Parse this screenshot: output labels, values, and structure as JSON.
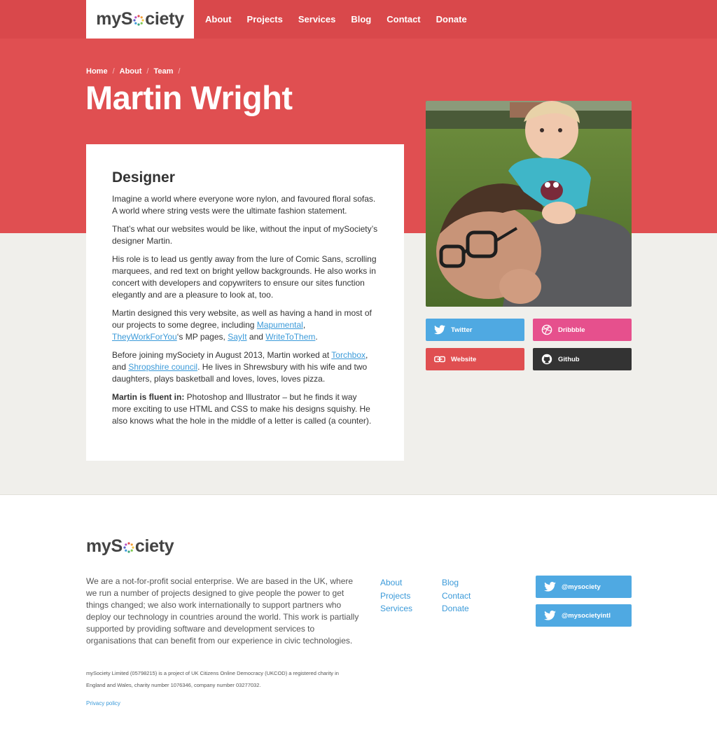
{
  "brand": {
    "logo_left": "myS",
    "logo_right": "ciety",
    "colors": {
      "header": "#d9484b",
      "hero": "#e04f51",
      "band": "#f0efeb",
      "link": "#3b9ad9",
      "twitter": "#4fa9e2",
      "dribbble": "#e6508d",
      "github": "#333333"
    }
  },
  "nav": {
    "items": [
      "About",
      "Projects",
      "Services",
      "Blog",
      "Contact",
      "Donate"
    ]
  },
  "breadcrumb": {
    "items": [
      "Home",
      "About",
      "Team"
    ],
    "separator": "/"
  },
  "profile": {
    "name": "Martin Wright",
    "role": "Designer",
    "p1": "Imagine a world where everyone wore nylon, and favoured floral sofas. A world where string vests were the ultimate fashion statement.",
    "p2": "That’s what our websites would be like, without the input of mySociety’s designer Martin.",
    "p3": "His role is to lead us gently away from the lure of Comic Sans, scrolling marquees, and red text on bright yellow backgrounds. He also works in concert with developers and copywriters to ensure our sites function elegantly and are a pleasure to look at, too.",
    "p4": {
      "a": "Martin designed this very website, as well as having a hand in most of our projects to some degree, including ",
      "link1": "Mapumental",
      "b": ", ",
      "link2": "TheyWorkForYou",
      "c": "‘s MP pages, ",
      "link3": "SayIt",
      "d": " and ",
      "link4": "WriteToThem",
      "e": "."
    },
    "p5": {
      "a": "Before joining mySociety in August 2013, Martin worked at ",
      "link1": "Torchbox",
      "b": ", and ",
      "link2": "Shropshire council",
      "c": ". He lives in Shrewsbury with his wife and two daughters, plays basketball and loves, loves, loves pizza."
    },
    "p6": {
      "label": "Martin is fluent in:",
      "text": " Photoshop and Illustrator – but he finds it way more exciting to use HTML and CSS to make his designs squishy. He also knows what the hole in the middle of a letter is called (a counter)."
    }
  },
  "social": {
    "twitter": {
      "label": "Twitter",
      "icon": "twitter-icon"
    },
    "dribbble": {
      "label": "Dribbble",
      "icon": "dribbble-icon"
    },
    "website": {
      "label": "Website",
      "icon": "link-icon"
    },
    "github": {
      "label": "Github",
      "icon": "github-icon"
    }
  },
  "footer": {
    "about": "We are a not-for-profit social enterprise. We are based in the UK, where we run a number of projects designed to give people the power to get things changed; we also work internationally to support partners who deploy our technology in countries around the world. This work is partially supported by providing software and development services to organisations that can benefit from our experience in civic technologies.",
    "links_col1": [
      "About",
      "Projects",
      "Services"
    ],
    "links_col2": [
      "Blog",
      "Contact",
      "Donate"
    ],
    "twitter1": "@mysociety",
    "twitter2": "@mysocietyintl",
    "legal": "mySociety Limited (05798215) is a project of UK Citizens Online Democracy (UKCOD) a registered charity in England and Wales, charity number 1076346, company number 03277032.",
    "privacy": "Privacy policy"
  }
}
